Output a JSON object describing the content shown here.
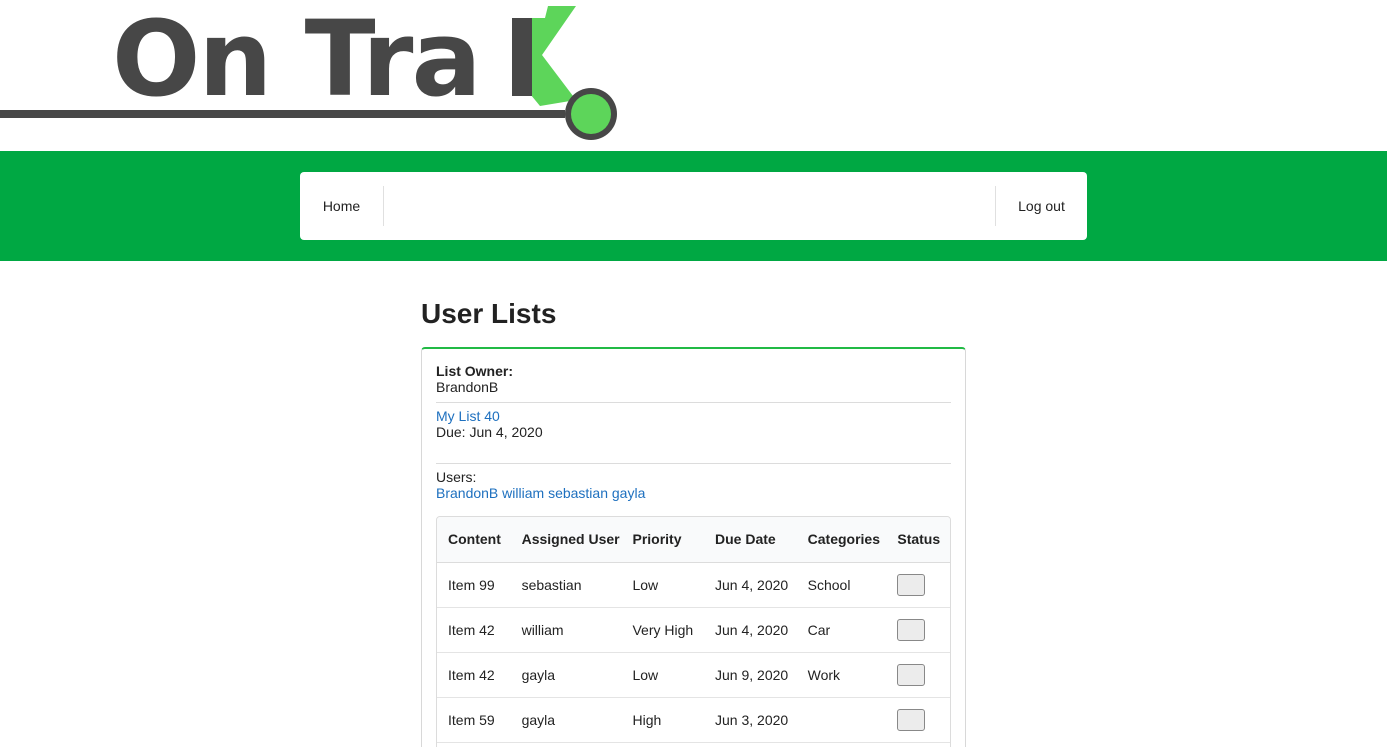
{
  "logo": {
    "text_part": "On Tra",
    "letter": "K",
    "colors": {
      "dark": "#474747",
      "green": "#5dd55a"
    }
  },
  "colors": {
    "band": "#00a843",
    "link": "#1e70bf",
    "card_accent": "#21ba45"
  },
  "nav": {
    "home_label": "Home",
    "logout_label": "Log out"
  },
  "page": {
    "title": "User Lists"
  },
  "card": {
    "owner_label": "List Owner:",
    "owner_value": "BrandonB",
    "list_name": "My List 40",
    "due": "Due: Jun 4, 2020",
    "users_label": "Users:",
    "users": [
      "BrandonB",
      "william",
      "sebastian",
      "gayla"
    ]
  },
  "table": {
    "headers": [
      "Content",
      "Assigned User",
      "Priority",
      "Due Date",
      "Categories",
      "Status"
    ],
    "rows": [
      {
        "content": "Item 99",
        "user": "sebastian",
        "priority": "Low",
        "due": "Jun 4, 2020",
        "category": "School"
      },
      {
        "content": "Item 42",
        "user": "william",
        "priority": "Very High",
        "due": "Jun 4, 2020",
        "category": "Car"
      },
      {
        "content": "Item 42",
        "user": "gayla",
        "priority": "Low",
        "due": "Jun 9, 2020",
        "category": "Work"
      },
      {
        "content": "Item 59",
        "user": "gayla",
        "priority": "High",
        "due": "Jun 3, 2020",
        "category": ""
      }
    ]
  }
}
